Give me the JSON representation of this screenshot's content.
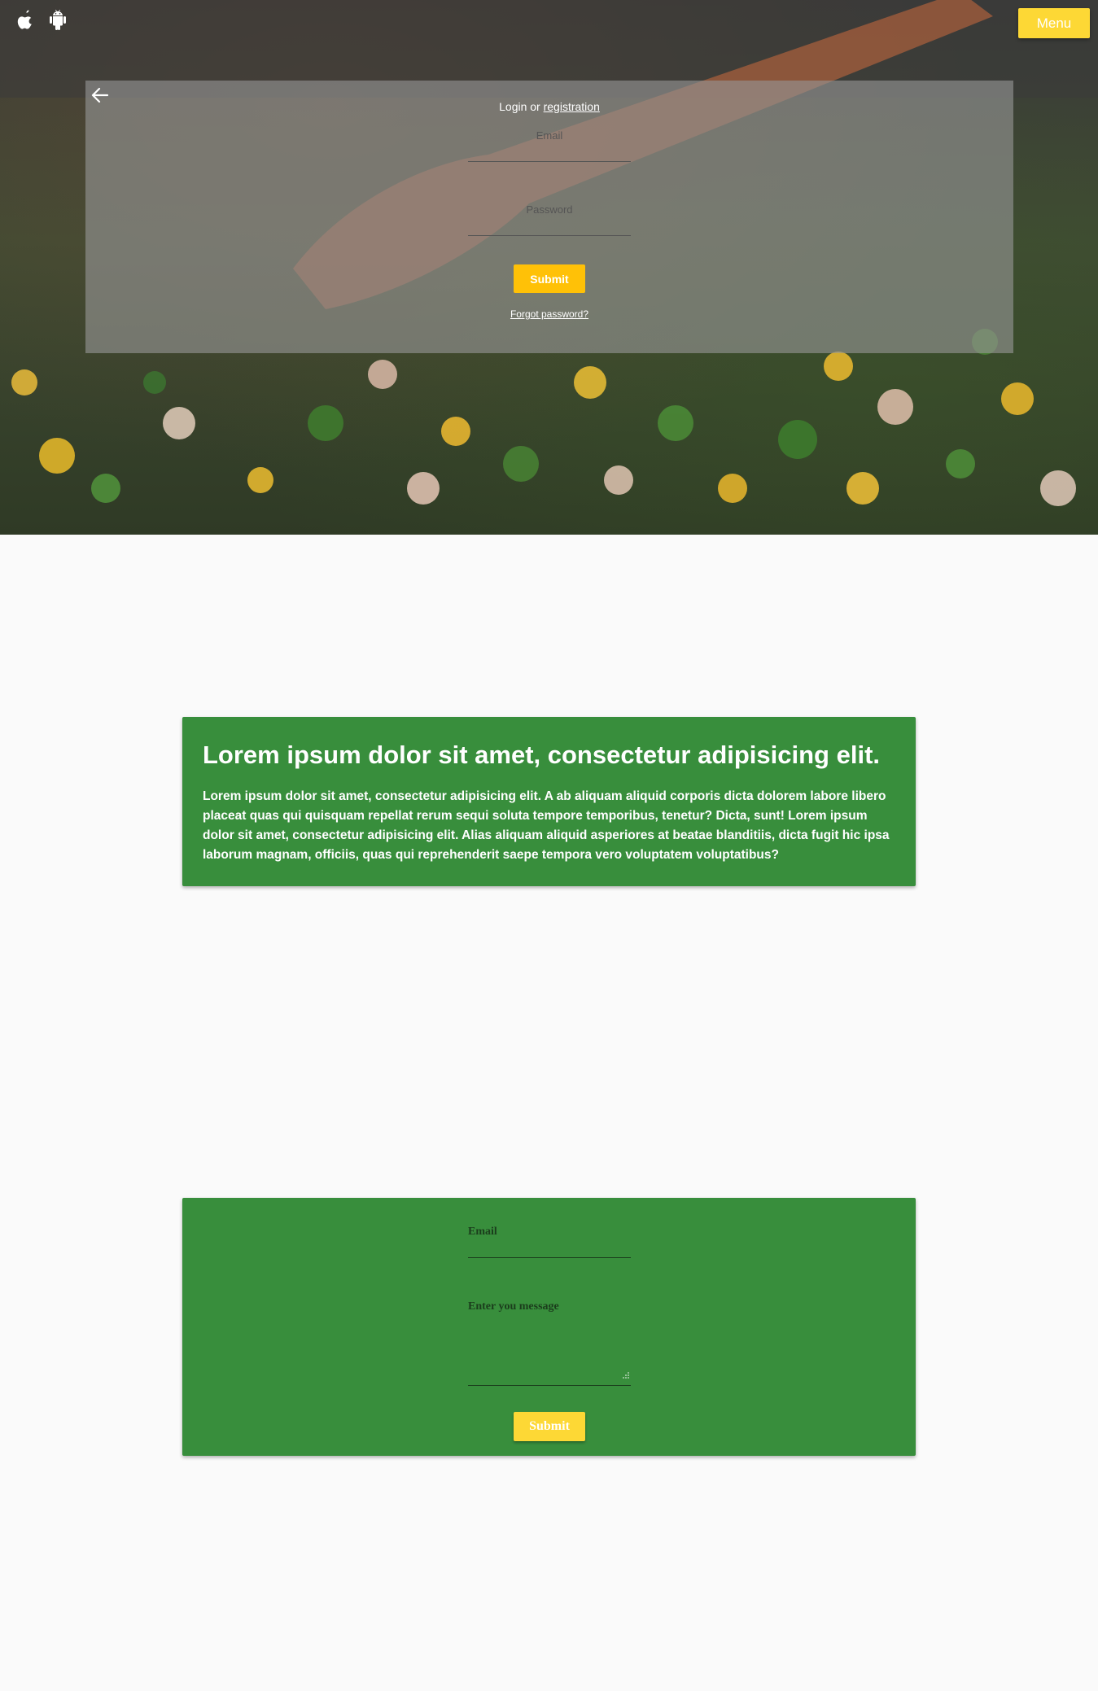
{
  "header": {
    "apple_icon": "apple-icon",
    "android_icon": "android-icon",
    "menu_label": "Menu"
  },
  "login": {
    "title_prefix": "Login or",
    "registration_link": "registration",
    "email_label": "Email",
    "password_label": "Password",
    "submit_label": "Submit",
    "forgot_link": "Forgot password?"
  },
  "info": {
    "heading": "Lorem ipsum dolor sit amet, consectetur adipisicing elit.",
    "body": "Lorem ipsum dolor sit amet, consectetur adipisicing elit. A ab aliquam aliquid corporis dicta dolorem labore libero placeat quas qui quisquam repellat rerum sequi soluta tempore temporibus, tenetur? Dicta, sunt! Lorem ipsum dolor sit amet, consectetur adipisicing elit. Alias aliquam aliquid asperiores at beatae blanditiis, dicta fugit hic ipsa laborum magnam, officiis, quas qui reprehenderit saepe tempora vero voluptatem voluptatibus?"
  },
  "contact": {
    "email_label": "Email",
    "message_label": "Enter you message",
    "submit_label": "Submit"
  },
  "colors": {
    "accent_yellow": "#fdd835",
    "submit_amber": "#ffc107",
    "card_green": "#388e3c",
    "page_bg": "#fafafa"
  }
}
